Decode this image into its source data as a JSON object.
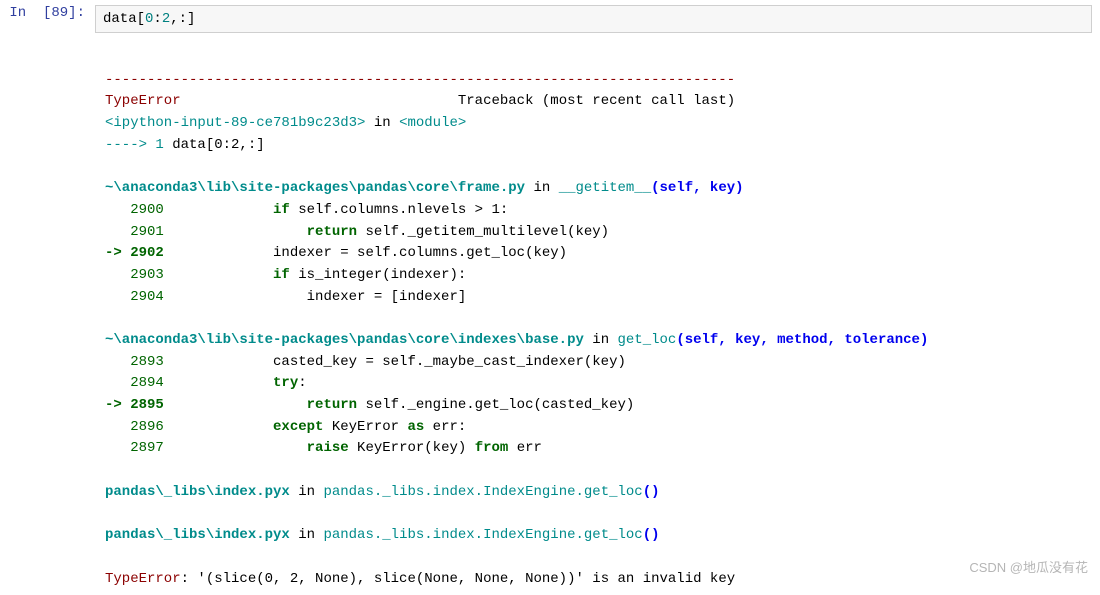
{
  "prompt": "In  [89]:",
  "code_input": "data[0:2,:]",
  "dash_line": "---------------------------------------------------------------------------",
  "error_name": "TypeError",
  "traceback_label": "Traceback (most recent call last)",
  "ipython_input": "<ipython-input-89-ce781b9c23d3>",
  "in_word": " in ",
  "module_word": "<module>",
  "arrow1_line": "----> 1 ",
  "arrow1_code": "data[0:2,:]",
  "frame1_path": "~\\anaconda3\\lib\\site-packages\\pandas\\core\\frame.py",
  "frame1_func": "__getitem__",
  "frame1_args": "(self, key)",
  "f1_ln1": "   2900",
  "f1_c1a": "             if",
  "f1_c1b": " self.columns.nlevels > 1:",
  "f1_ln2": "   2901",
  "f1_c2a": "                 return",
  "f1_c2b": " self._getitem_multilevel(key)",
  "f1_ln3": "-> 2902",
  "f1_c3": "             indexer = self.columns.get_loc(key)",
  "f1_ln4": "   2903",
  "f1_c4a": "             if",
  "f1_c4b": " is_integer(indexer):",
  "f1_ln5": "   2904",
  "f1_c5": "                 indexer = [indexer]",
  "frame2_path": "~\\anaconda3\\lib\\site-packages\\pandas\\core\\indexes\\base.py",
  "frame2_func": "get_loc",
  "frame2_args": "(self, key, method, tolerance)",
  "f2_ln1": "   2893",
  "f2_c1": "             casted_key = self._maybe_cast_indexer(key)",
  "f2_ln2": "   2894",
  "f2_c2a": "             try",
  "f2_c2b": ":",
  "f2_ln3": "-> 2895",
  "f2_c3a": "                 return",
  "f2_c3b": " self._engine.get_loc(casted_key)",
  "f2_ln4": "   2896",
  "f2_c4a": "             except",
  "f2_c4b": " KeyError ",
  "f2_c4c": "as",
  "f2_c4d": " err:",
  "f2_ln5": "   2897",
  "f2_c5a": "                 raise",
  "f2_c5b": " KeyError(key) ",
  "f2_c5c": "from",
  "f2_c5d": " err",
  "pyx_path": "pandas\\_libs\\index.pyx",
  "pyx_func": "pandas._libs.index.IndexEngine.get_loc",
  "pyx_parens": "()",
  "final_error": "TypeError",
  "final_msg": ": '(slice(0, 2, None), slice(None, None, None))' is an invalid key",
  "watermark": "CSDN @地瓜没有花"
}
